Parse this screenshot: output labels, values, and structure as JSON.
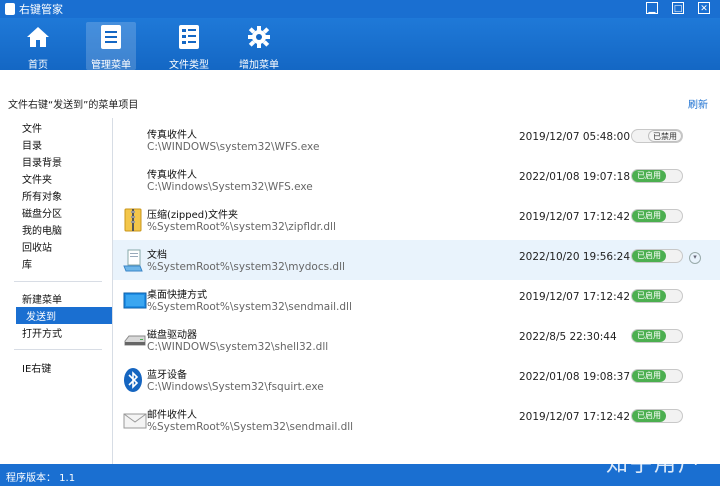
{
  "window": {
    "title": "右键管家",
    "min_label": "▁",
    "max_label": "□",
    "close_label": "✕"
  },
  "toolbar": {
    "items": [
      {
        "label": "首页",
        "icon": "home-icon"
      },
      {
        "label": "管理菜单",
        "icon": "list-icon"
      },
      {
        "label": "文件类型",
        "icon": "filetype-icon"
      },
      {
        "label": "增加菜单",
        "icon": "gear-icon"
      }
    ]
  },
  "header": {
    "title": "文件右键“发送到”的菜单项目",
    "refresh_label": "刷新"
  },
  "sidebar": {
    "group1": [
      "文件",
      "目录",
      "目录背景",
      "文件夹",
      "所有对象",
      "磁盘分区",
      "我的电脑",
      "回收站",
      "库"
    ],
    "group2": [
      "新建菜单",
      "发送到",
      "打开方式"
    ],
    "group3": [
      "IE右键"
    ],
    "selected": "发送到"
  },
  "rows": [
    {
      "name": "传真收件人",
      "path": "C:\\WINDOWS\\system32\\WFS.exe",
      "date": "2019/12/07 05:48:00",
      "status": "已禁用",
      "enabled": false,
      "icon": "none"
    },
    {
      "name": "传真收件人",
      "path": "C:\\Windows\\System32\\WFS.exe",
      "date": "2022/01/08 19:07:18",
      "status": "已启用",
      "enabled": true,
      "icon": "none"
    },
    {
      "name": "压缩(zipped)文件夹",
      "path": "%SystemRoot%\\system32\\zipfldr.dll",
      "date": "2019/12/07 17:12:42",
      "status": "已启用",
      "enabled": true,
      "icon": "zip-folder-icon"
    },
    {
      "name": "文档",
      "path": "%SystemRoot%\\system32\\mydocs.dll",
      "date": "2022/10/20 19:56:24",
      "status": "已启用",
      "enabled": true,
      "icon": "documents-icon"
    },
    {
      "name": "桌面快捷方式",
      "path": "%SystemRoot%\\system32\\sendmail.dll",
      "date": "2019/12/07 17:12:42",
      "status": "已启用",
      "enabled": true,
      "icon": "desktop-icon"
    },
    {
      "name": "磁盘驱动器",
      "path": "C:\\WINDOWS\\system32\\shell32.dll",
      "date": "2022/8/5 22:30:44",
      "status": "已启用",
      "enabled": true,
      "icon": "drive-icon"
    },
    {
      "name": "蓝牙设备",
      "path": "C:\\Windows\\System32\\fsquirt.exe",
      "date": "2022/01/08 19:08:37",
      "status": "已启用",
      "enabled": true,
      "icon": "bluetooth-icon"
    },
    {
      "name": "邮件收件人",
      "path": "%SystemRoot%\\System32\\sendmail.dll",
      "date": "2019/12/07 17:12:42",
      "status": "已启用",
      "enabled": true,
      "icon": "mail-icon"
    }
  ],
  "status_bar": {
    "version_text": "程序版本： 1.1",
    "watermark": "知乎用户"
  },
  "colors": {
    "accent": "#1a6fd1",
    "enabled": "#4caf50",
    "selected_row": "#e9f3fc"
  }
}
